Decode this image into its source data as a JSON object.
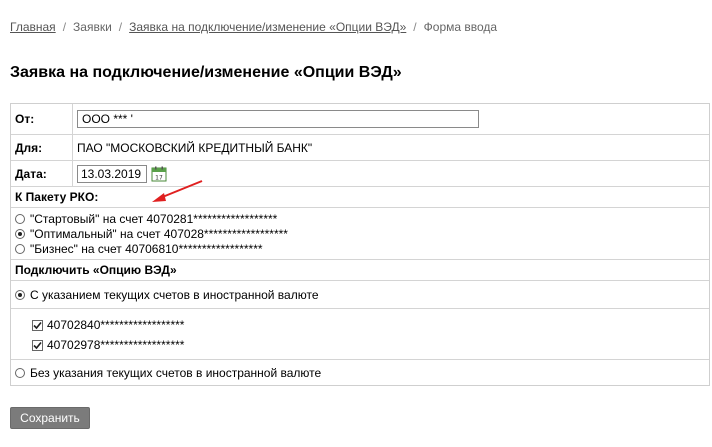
{
  "breadcrumb": {
    "home": "Главная",
    "requests": "Заявки",
    "parent": "Заявка на подключение/изменение «Опции ВЭД»",
    "current": "Форма ввода"
  },
  "page_title": "Заявка на подключение/изменение «Опции ВЭД»",
  "form": {
    "from_label": "От:",
    "from_value": "ООО *** '",
    "for_label": "Для:",
    "for_value": "ПАО \"МОСКОВСКИЙ КРЕДИТНЫЙ БАНК\"",
    "date_label": "Дата:",
    "date_value": "13.03.2019",
    "rko_title": "К Пакету РКО:",
    "rko_options": [
      {
        "label": "\"Стартовый\" на счет 4070281******************",
        "checked": false
      },
      {
        "label": "\"Оптимальный\" на счет 407028******************",
        "checked": true
      },
      {
        "label": "\"Бизнес\" на счет 40706810******************",
        "checked": false
      }
    ],
    "ved_title": "Подключить «Опцию ВЭД»",
    "with_accounts": "С указанием текущих счетов в иностранной валюте",
    "accounts": [
      {
        "label": "40702840******************",
        "checked": true
      },
      {
        "label": "40702978******************",
        "checked": true
      }
    ],
    "without_accounts": "Без указания текущих счетов в иностранной валюте"
  },
  "save_label": "Сохранить",
  "colors": {
    "annotation_arrow": "#e02020",
    "button_bg": "#7b7b7b",
    "calendar_icon": "#4a8a3a"
  }
}
